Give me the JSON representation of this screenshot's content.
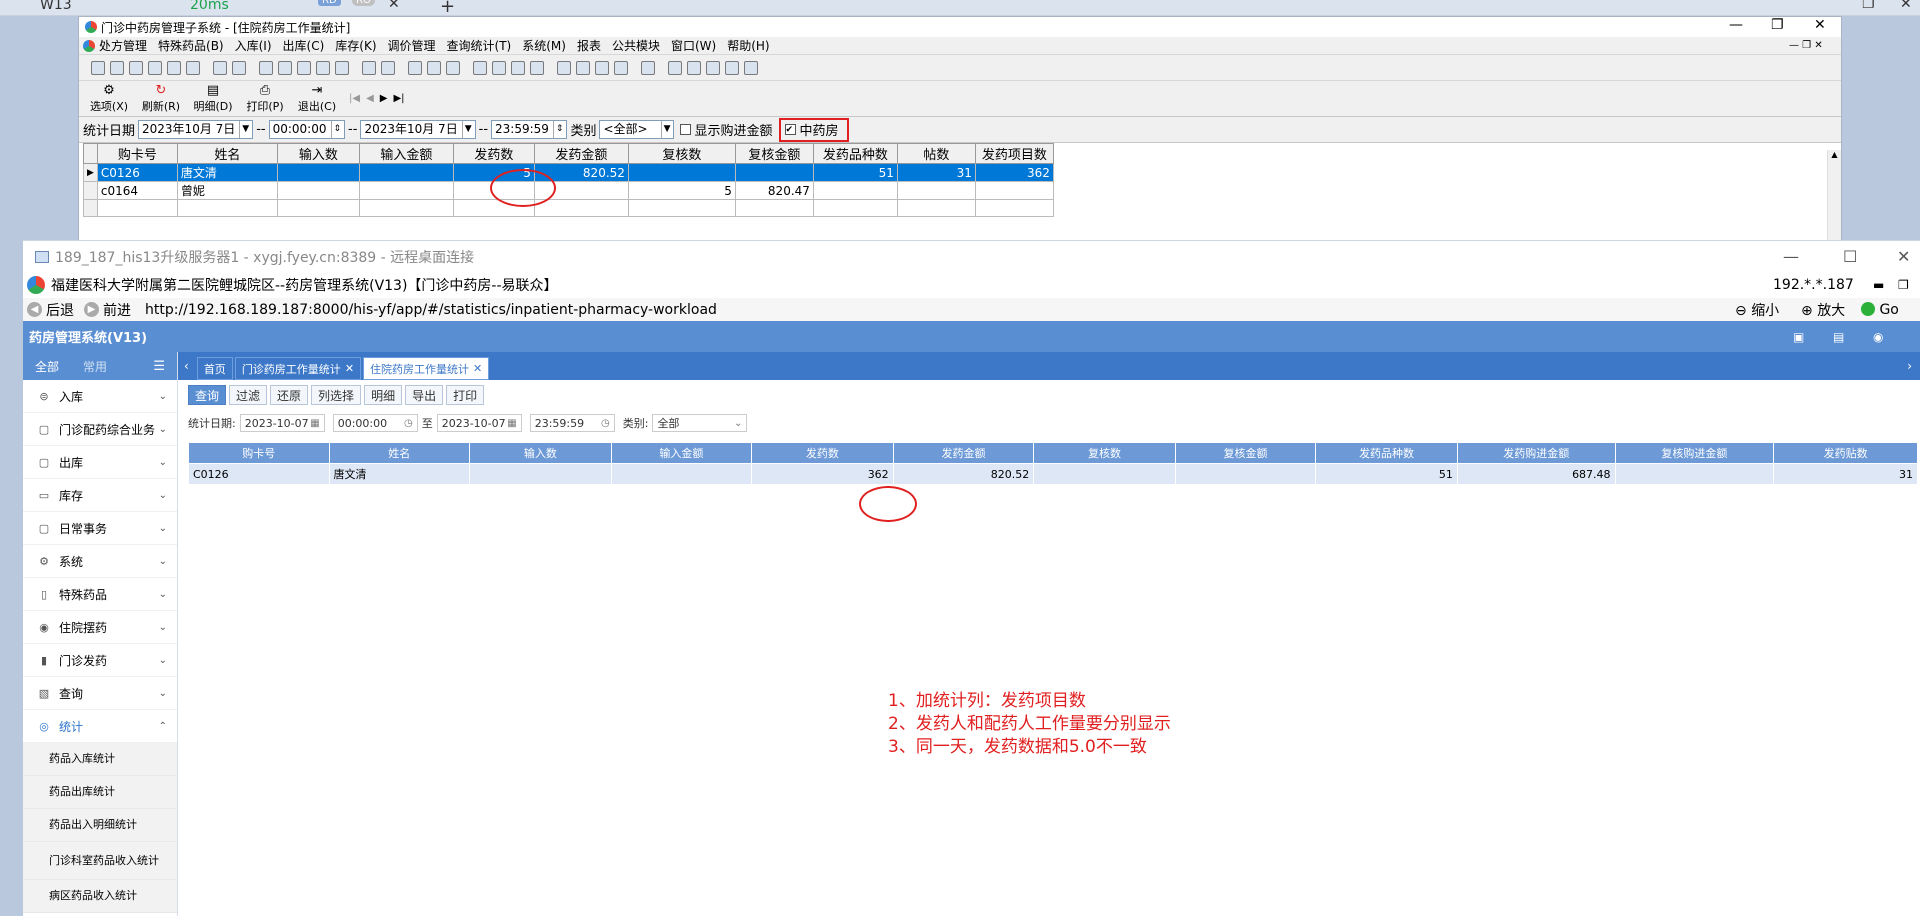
{
  "host": {
    "tab_title": "W13",
    "ping": "20ms",
    "badge_rd": "RD",
    "badge_ro": "RO"
  },
  "old_app": {
    "title": "门诊中药房管理子系统 - [住院药房工作量统计]",
    "menu": [
      "处方管理",
      "特殊药品(B)",
      "入库(I)",
      "出库(C)",
      "库存(K)",
      "调价管理",
      "查询统计(T)",
      "系统(M)",
      "报表",
      "公共模块",
      "窗口(W)",
      "帮助(H)"
    ],
    "toolbar": [
      {
        "label": "选项(X)",
        "icon": "options-icon"
      },
      {
        "label": "刷新(R)",
        "icon": "refresh-icon"
      },
      {
        "label": "明细(D)",
        "icon": "detail-icon"
      },
      {
        "label": "打印(P)",
        "icon": "print-icon"
      },
      {
        "label": "退出(C)",
        "icon": "exit-icon"
      }
    ],
    "filter": {
      "label_date": "统计日期",
      "start_date": "2023年10月 7日",
      "start_time": "00:00:00",
      "sep": "--",
      "end_date": "2023年10月 7日",
      "end_time": "23:59:59",
      "label_type": "类别",
      "type_value": "<全部>",
      "show_purchase_label": "显示购进金额",
      "herbal_label": "中药房",
      "herbal_checked": "✔"
    },
    "columns": [
      "购卡号",
      "姓名",
      "输入数",
      "输入金额",
      "发药数",
      "发药金额",
      "复核数",
      "复核金额",
      "发药品种数",
      "帖数",
      "发药项目数"
    ],
    "rows": [
      [
        "C0126",
        "唐文清",
        "",
        "",
        "5",
        "820.52",
        "",
        "",
        "51",
        "31",
        "362"
      ],
      [
        "c0164",
        "曾妮",
        "",
        "",
        "",
        "",
        "5",
        "820.47",
        "",
        "",
        ""
      ]
    ]
  },
  "rdp": {
    "title": "189_187_his13升级服务器1 - xygj.fyey.cn:8389 - 远程桌面连接",
    "app_title": "福建医科大学附属第二医院鲤城院区--药房管理系统(V13)【门诊中药房--易联众】",
    "ip": "192.*.*.187",
    "back": "后退",
    "forward": "前进",
    "url": "http://192.168.189.187:8000/his-yf/app/#/statistics/inpatient-pharmacy-workload",
    "zoom_out": "缩小",
    "zoom_in": "放大",
    "go": "Go",
    "system_name": "药房管理系统(V13)"
  },
  "sidebar": {
    "tab_all": "全部",
    "tab_common": "常用",
    "items": [
      {
        "label": "入库",
        "icon": "inbound-icon"
      },
      {
        "label": "门诊配药综合业务",
        "icon": "clinic-icon"
      },
      {
        "label": "出库",
        "icon": "outbound-icon"
      },
      {
        "label": "库存",
        "icon": "stock-icon"
      },
      {
        "label": "日常事务",
        "icon": "daily-icon"
      },
      {
        "label": "系统",
        "icon": "gear-icon"
      },
      {
        "label": "特殊药品",
        "icon": "special-drug-icon"
      },
      {
        "label": "住院摆药",
        "icon": "inpatient-icon"
      },
      {
        "label": "门诊发药",
        "icon": "dispense-icon"
      },
      {
        "label": "查询",
        "icon": "query-icon"
      },
      {
        "label": "统计",
        "icon": "stats-icon"
      }
    ],
    "sub_items": [
      "药品入库统计",
      "药品出库统计",
      "药品出入明细统计",
      "门诊科室药品收入统计",
      "病区药品收入统计"
    ]
  },
  "main": {
    "tabs": [
      "首页",
      "门诊药房工作量统计",
      "住院药房工作量统计"
    ],
    "buttons": [
      "查询",
      "过滤",
      "还原",
      "列选择",
      "明细",
      "导出",
      "打印"
    ],
    "filter": {
      "label_date": "统计日期:",
      "start_date": "2023-10-07",
      "start_time": "00:00:00",
      "to": "至",
      "end_date": "2023-10-07",
      "end_time": "23:59:59",
      "label_type": "类别:",
      "type_value": "全部"
    },
    "columns": [
      "购卡号",
      "姓名",
      "输入数",
      "输入金额",
      "发药数",
      "发药金额",
      "复核数",
      "复核金额",
      "发药品种数",
      "发药购进金额",
      "复核购进金额",
      "发药贴数"
    ],
    "rows": [
      [
        "C0126",
        "唐文清",
        "",
        "",
        "362",
        "820.52",
        "",
        "",
        "51",
        "687.48",
        "",
        "31"
      ]
    ]
  },
  "notes": [
    "1、加统计列：发药项目数",
    "2、发药人和配药人工作量要分别显示",
    "3、同一天，发药数据和5.0不一致"
  ]
}
